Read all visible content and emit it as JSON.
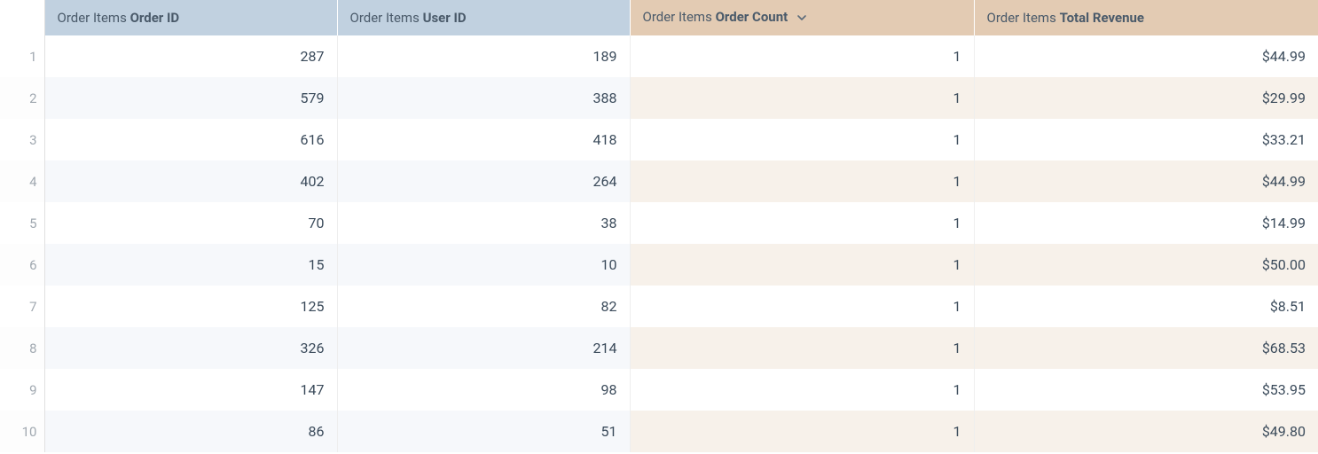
{
  "table": {
    "header_prefix": "Order Items",
    "columns": [
      {
        "key": "order_id",
        "label": "Order ID",
        "type": "dimension",
        "sorted": false
      },
      {
        "key": "user_id",
        "label": "User ID",
        "type": "dimension",
        "sorted": false
      },
      {
        "key": "order_count",
        "label": "Order Count",
        "type": "measure",
        "sorted": "desc"
      },
      {
        "key": "total_revenue",
        "label": "Total Revenue",
        "type": "measure",
        "sorted": false
      }
    ],
    "rows": [
      {
        "n": "1",
        "order_id": "287",
        "user_id": "189",
        "order_count": "1",
        "total_revenue": "$44.99"
      },
      {
        "n": "2",
        "order_id": "579",
        "user_id": "388",
        "order_count": "1",
        "total_revenue": "$29.99"
      },
      {
        "n": "3",
        "order_id": "616",
        "user_id": "418",
        "order_count": "1",
        "total_revenue": "$33.21"
      },
      {
        "n": "4",
        "order_id": "402",
        "user_id": "264",
        "order_count": "1",
        "total_revenue": "$44.99"
      },
      {
        "n": "5",
        "order_id": "70",
        "user_id": "38",
        "order_count": "1",
        "total_revenue": "$14.99"
      },
      {
        "n": "6",
        "order_id": "15",
        "user_id": "10",
        "order_count": "1",
        "total_revenue": "$50.00"
      },
      {
        "n": "7",
        "order_id": "125",
        "user_id": "82",
        "order_count": "1",
        "total_revenue": "$8.51"
      },
      {
        "n": "8",
        "order_id": "326",
        "user_id": "214",
        "order_count": "1",
        "total_revenue": "$68.53"
      },
      {
        "n": "9",
        "order_id": "147",
        "user_id": "98",
        "order_count": "1",
        "total_revenue": "$53.95"
      },
      {
        "n": "10",
        "order_id": "86",
        "user_id": "51",
        "order_count": "1",
        "total_revenue": "$49.80"
      }
    ]
  },
  "colors": {
    "dimension_header_bg": "#c1d1e0",
    "measure_header_bg": "#e3cbb3",
    "dimension_stripe_bg": "#f6f8fb",
    "measure_stripe_bg": "#f7f1ea"
  }
}
